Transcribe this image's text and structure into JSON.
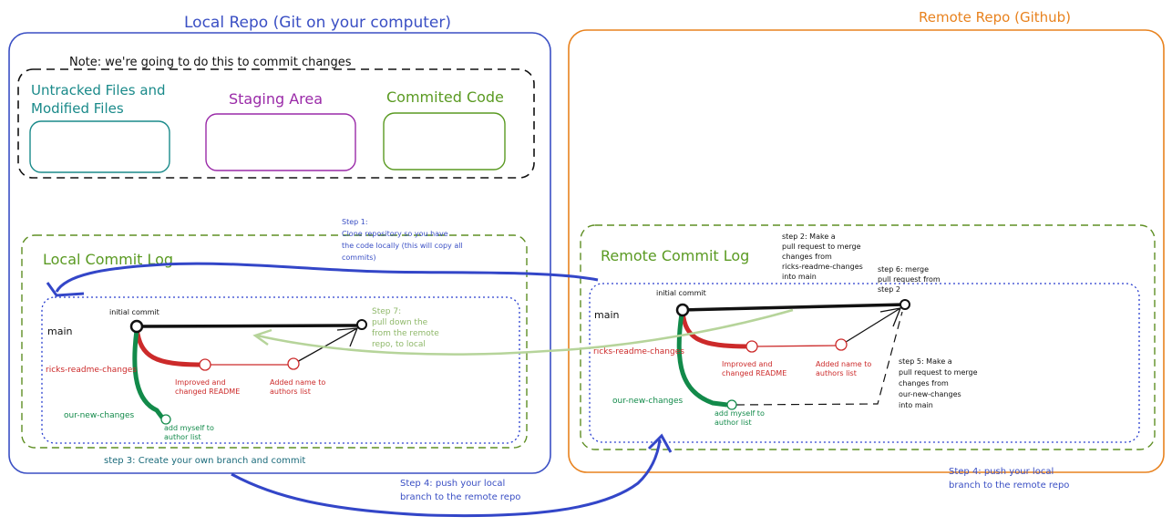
{
  "local_repo": {
    "title": "Local Repo (Git on your computer)",
    "note": "Note: we're going to do this to commit changes",
    "untracked_line1": "Untracked Files and",
    "untracked_line2": "Modified Files",
    "staging": "Staging Area",
    "committed": "Commited Code",
    "commit_log_title": "Local Commit Log",
    "branch_main": "main",
    "branch_ricks": "ricks-readme-changes",
    "branch_ours": "our-new-changes",
    "initial_commit": "initial commit",
    "improved_1": "Improved and",
    "improved_2": "changed README",
    "added_1": "Added name to",
    "added_2": "authors list",
    "myself_1": "add myself to",
    "myself_2": "author list",
    "step7_1": "Step 7:",
    "step7_2": "pull down the",
    "step7_3": "from the remote",
    "step7_4": "repo, to local",
    "step3": "step 3: Create your own branch and commit"
  },
  "remote_repo": {
    "title": "Remote Repo (Github)",
    "commit_log_title": "Remote Commit Log",
    "branch_main": "main",
    "branch_ricks": "ricks-readme-changes",
    "branch_ours": "our-new-changes",
    "initial_commit": "initial commit",
    "improved_1": "Improved and",
    "improved_2": "changed README",
    "added_1": "Added name to",
    "added_2": "authors list",
    "myself_1": "add myself to",
    "myself_2": "author list",
    "step2_1": "step 2: Make a",
    "step2_2": "pull request to merge",
    "step2_3": "changes from",
    "step2_4": "ricks-readme-changes",
    "step2_5": "into main",
    "step6_1": "step 6: merge",
    "step6_2": "pull request from",
    "step6_3": "step 2",
    "step5_1": "step 5: Make a",
    "step5_2": "pull request to merge",
    "step5_3": "changes from",
    "step5_4": "our-new-changes",
    "step5_5": "into main",
    "step4_1": "Step 4: push your local",
    "step4_2": "branch to the remote repo"
  },
  "step1": {
    "line1": "Step 1:",
    "line2": "Clone repository so you have",
    "line3": "the code locally (this will copy all",
    "line4": "commits)"
  },
  "step4_middle": {
    "line1": "Step 4: push your local",
    "line2": "branch to the remote repo"
  },
  "colors": {
    "local_border": "#3a4fc4",
    "remote_border": "#e8821e",
    "teal": "#1a8a8a",
    "purple": "#9a2aa8",
    "green": "#5a9a22",
    "dashed_green": "#5f8f24",
    "dotted_blue": "#2a3fcf",
    "red": "#cc2a2a",
    "branch_green": "#128a4a",
    "arrow_blue": "#3346c8",
    "light_green": "#b6d49a",
    "black": "#111111"
  }
}
